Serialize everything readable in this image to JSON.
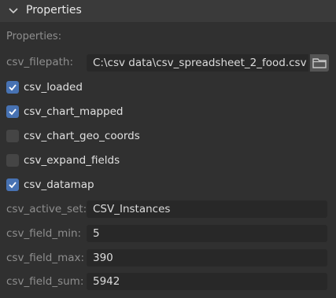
{
  "panel": {
    "title": "Properties",
    "section_label": "Properties:"
  },
  "filepath": {
    "label": "csv_filepath:",
    "value": "C:\\csv data\\csv_spreadsheet_2_food.csv"
  },
  "checkboxes": [
    {
      "label": "csv_loaded",
      "checked": true
    },
    {
      "label": "csv_chart_mapped",
      "checked": true
    },
    {
      "label": "csv_chart_geo_coords",
      "checked": false
    },
    {
      "label": "csv_expand_fields",
      "checked": false
    },
    {
      "label": "csv_datamap",
      "checked": true
    }
  ],
  "fields": [
    {
      "label": "csv_active_set:",
      "value": "CSV_Instances"
    },
    {
      "label": "csv_field_min:",
      "value": "5"
    },
    {
      "label": "csv_field_max:",
      "value": "390"
    },
    {
      "label": "csv_field_sum:",
      "value": "5942"
    }
  ],
  "colors": {
    "checkbox_on": "#4772b3",
    "checkbox_off": "#454545",
    "background": "#303030",
    "field_bg": "#282828"
  },
  "icons": {
    "header": "chevron-down-icon",
    "folder": "folder-icon",
    "check": "checkmark-icon"
  }
}
